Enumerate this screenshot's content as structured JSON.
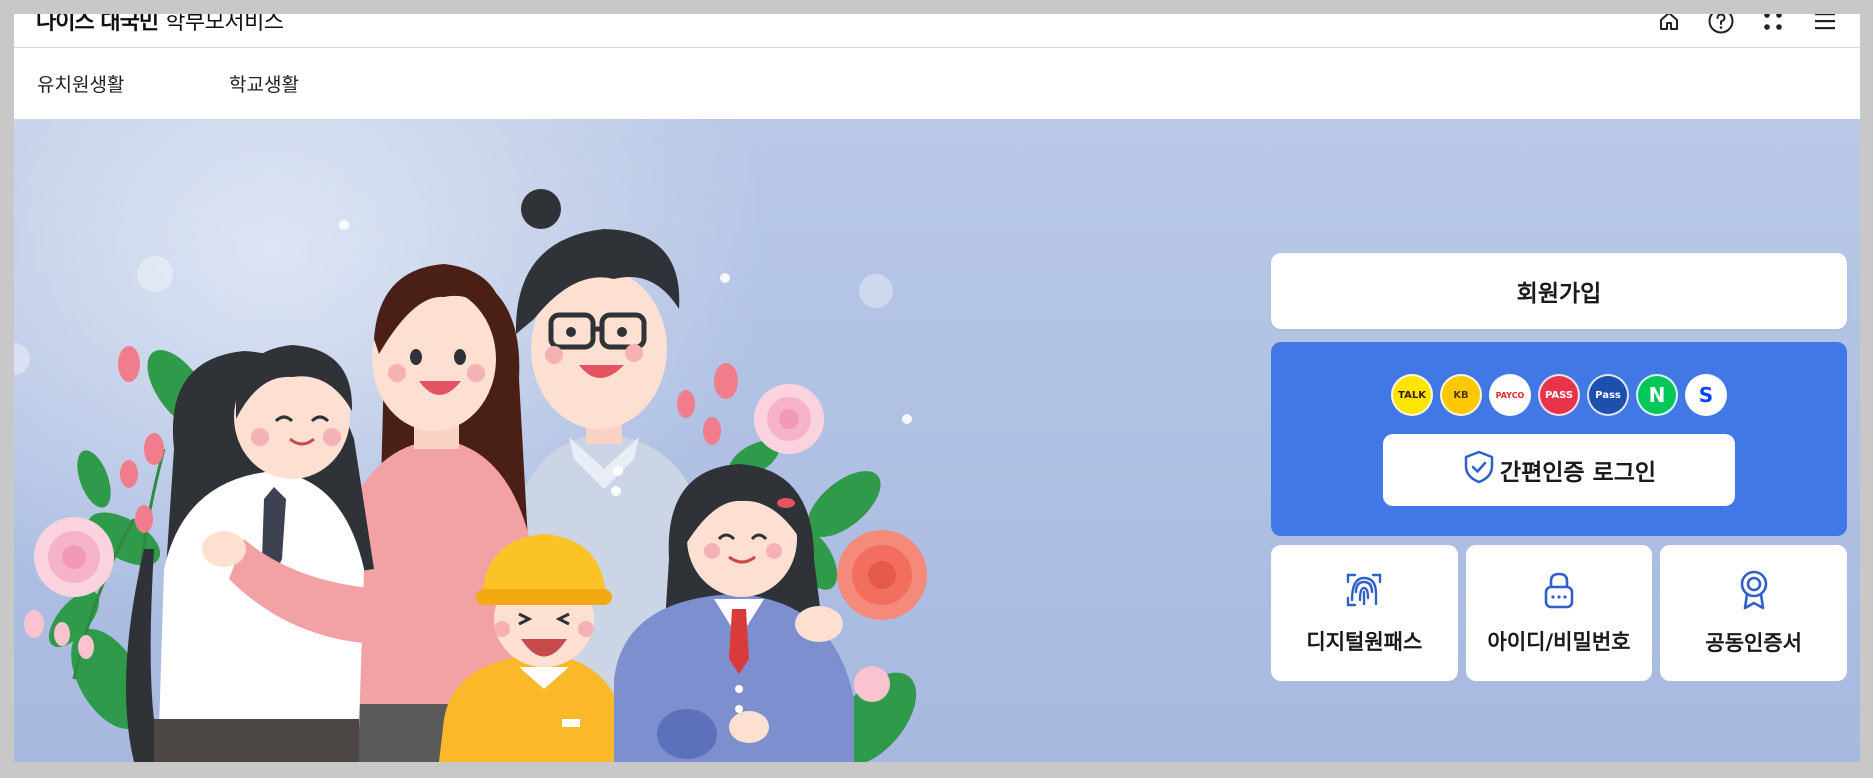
{
  "header": {
    "logo_brand": "나이스 대국민",
    "logo_service": "학부모서비스",
    "icons": [
      "home-icon",
      "help-icon",
      "apps-icon",
      "menu-icon"
    ]
  },
  "nav": {
    "items": [
      {
        "label": "유치원생활"
      },
      {
        "label": "학교생활"
      }
    ]
  },
  "login": {
    "join_label": "회원가입",
    "easy_login_label": "간편인증 로그인",
    "providers": [
      {
        "name": "kakao",
        "text": "TALK",
        "bg": "#fde500",
        "fg": "#3a1d1d"
      },
      {
        "name": "kb",
        "text": "KB",
        "bg": "#fec800",
        "fg": "#4a3b00"
      },
      {
        "name": "payco",
        "text": "PAYCO",
        "bg": "#ffffff",
        "fg": "#e3262a"
      },
      {
        "name": "pass",
        "text": "PASS",
        "bg": "#e8344a",
        "fg": "#ffffff"
      },
      {
        "name": "samsung-pass",
        "text": "Pass",
        "bg": "#1d4fae",
        "fg": "#ffffff"
      },
      {
        "name": "naver",
        "text": "N",
        "bg": "#03c75a",
        "fg": "#ffffff"
      },
      {
        "name": "shinhan",
        "text": "S",
        "bg": "#ffffff",
        "fg": "#0046ff"
      }
    ],
    "tiles": [
      {
        "label": "디지털원패스",
        "icon": "fingerprint-icon"
      },
      {
        "label": "아이디/비밀번호",
        "icon": "lock-icon"
      },
      {
        "label": "공동인증서",
        "icon": "certificate-icon"
      }
    ]
  },
  "colors": {
    "accent": "#4178e6",
    "hero_bg": "#b0c0e4",
    "icon_blue": "#2f5fc8"
  }
}
